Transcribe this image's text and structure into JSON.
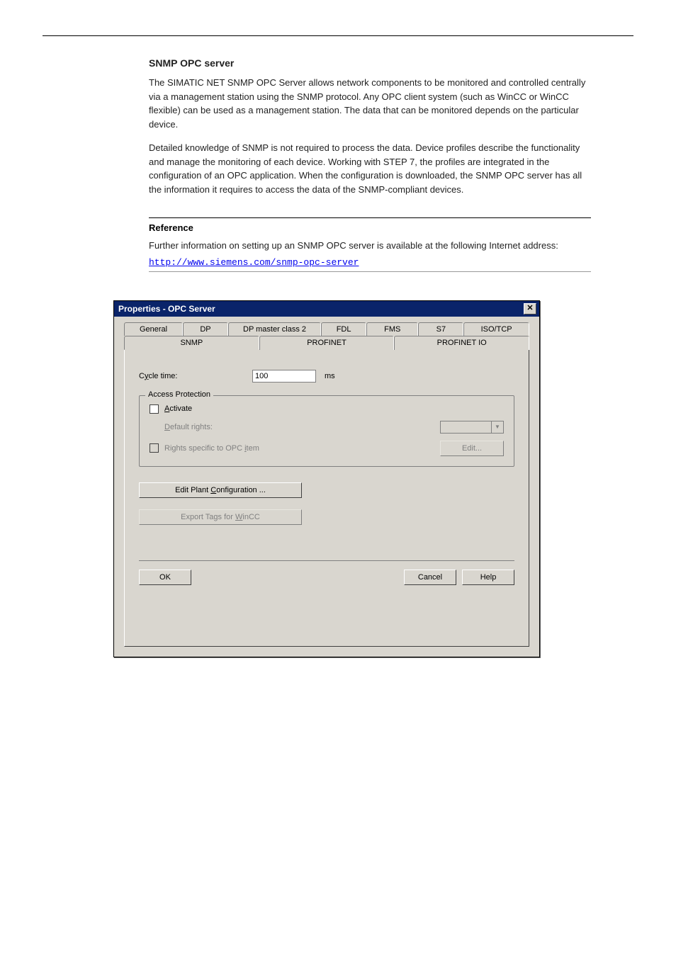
{
  "doc": {
    "section_title": "SNMP OPC server",
    "p1": "The SIMATIC NET SNMP OPC Server allows network components to be monitored and controlled centrally via a management station using the SNMP protocol. Any OPC client system (such as WinCC or WinCC flexible) can be used as a management station. The data that can be monitored depends on the particular device.",
    "p2": "Detailed knowledge of SNMP is not required to process the data. Device profiles describe the functionality and manage the monitoring of each device. Working with STEP 7, the profiles are integrated in the configuration of an OPC application. When the configuration is downloaded, the SNMP OPC server has all the information it requires to access the data of the SNMP-compliant devices.",
    "reference_heading": "Reference",
    "reference_text": "Further information on setting up an SNMP OPC server is available at the following Internet address:",
    "link_text": "http://www.siemens.com/snmp-opc-server"
  },
  "dialog": {
    "title": "Properties - OPC Server",
    "close_glyph": "✕",
    "tabs_row1": [
      "General",
      "DP",
      "DP master class 2",
      "FDL",
      "FMS",
      "S7",
      "ISO/TCP"
    ],
    "tabs_row2": [
      "SNMP",
      "PROFINET",
      "PROFINET IO"
    ],
    "active_tab": "SNMP",
    "cycle_time_label_pre": "C",
    "cycle_time_label_u": "y",
    "cycle_time_label_post": "cle time:",
    "cycle_time_value": "100",
    "cycle_time_unit": "ms",
    "group_legend": "Access Protection",
    "activate_u": "A",
    "activate_post": "ctivate",
    "default_rights_u": "D",
    "default_rights_post": "efault rights:",
    "rights_specific_u": "i",
    "rights_specific_pre": "Rights specific to OPC ",
    "rights_specific_post": "tem",
    "edit_btn": "Edit...",
    "edit_plant_pre": "Edit Plant ",
    "edit_plant_u": "C",
    "edit_plant_post": "onfiguration ...",
    "export_tags_pre": "Export Tags for ",
    "export_tags_u": "W",
    "export_tags_post": "inCC",
    "ok": "OK",
    "cancel": "Cancel",
    "help": "Help"
  }
}
